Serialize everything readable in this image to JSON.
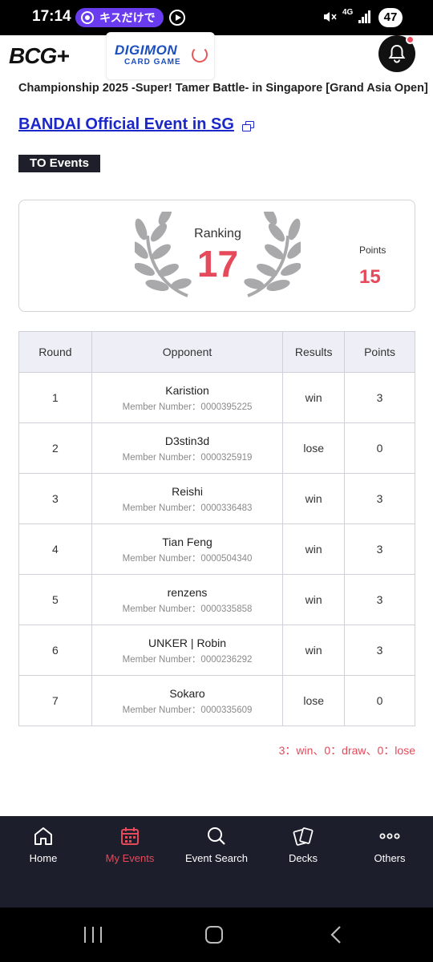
{
  "status_bar": {
    "time": "17:14",
    "notification_pill": "キスだけで",
    "network": "4G",
    "battery": "47"
  },
  "header": {
    "logo_left": "BCG+",
    "logo_game_line1": "DIGIMON",
    "logo_game_line2": "CARD GAME"
  },
  "event": {
    "title": "Championship 2025 -Super! Tamer Battle- in Singapore [Grand Asia Open]",
    "organizer_link": "BANDAI Official Event in SG",
    "badge": "TO Events"
  },
  "ranking_card": {
    "ranking_label": "Ranking",
    "ranking_value": "17",
    "points_label": "Points",
    "points_value": "15"
  },
  "results_table": {
    "headers": [
      "Round",
      "Opponent",
      "Results",
      "Points"
    ],
    "rows": [
      {
        "round": "1",
        "opponent": "Karistion",
        "member": "Member Number：0000395225",
        "result": "win",
        "points": "3"
      },
      {
        "round": "2",
        "opponent": "D3stin3d",
        "member": "Member Number：0000325919",
        "result": "lose",
        "points": "0"
      },
      {
        "round": "3",
        "opponent": "Reishi",
        "member": "Member Number：0000336483",
        "result": "win",
        "points": "3"
      },
      {
        "round": "4",
        "opponent": "Tian Feng",
        "member": "Member Number：0000504340",
        "result": "win",
        "points": "3"
      },
      {
        "round": "5",
        "opponent": "renzens",
        "member": "Member Number：0000335858",
        "result": "win",
        "points": "3"
      },
      {
        "round": "6",
        "opponent": "UNKER | Robin",
        "member": "Member Number：0000236292",
        "result": "win",
        "points": "3"
      },
      {
        "round": "7",
        "opponent": "Sokaro",
        "member": "Member Number：0000335609",
        "result": "lose",
        "points": "0"
      }
    ]
  },
  "summary": "3：win、0：draw、0：lose",
  "bottom_nav": {
    "items": [
      {
        "label": "Home",
        "icon": "home-icon",
        "active": false
      },
      {
        "label": "My Events",
        "icon": "calendar-icon",
        "active": true
      },
      {
        "label": "Event Search",
        "icon": "search-icon",
        "active": false
      },
      {
        "label": "Decks",
        "icon": "cards-icon",
        "active": false
      },
      {
        "label": "Others",
        "icon": "more-icon",
        "active": false
      }
    ]
  },
  "colors": {
    "accent_red": "#e5495a",
    "link_blue": "#1b27c9",
    "nav_bg": "#1d1e2c",
    "header_row_bg": "#eeeef6"
  }
}
